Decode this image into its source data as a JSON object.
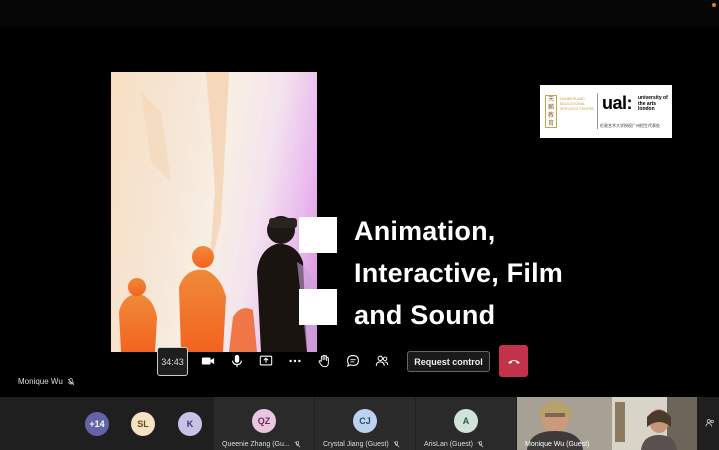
{
  "slide": {
    "title_lines": [
      "Animation,",
      "Interactive, Film",
      "and Sound"
    ],
    "logo": {
      "cn_vertical": "天麟教育",
      "en_text": "DUNBERLAND EDUCATIONAL SERVICES CENTRE",
      "ual_mark": "ual:",
      "ual_sub": "university of the arts london",
      "cn_sub": "伦敦艺术大学授权广州招生代表处"
    }
  },
  "toolbar": {
    "timer": "34:43",
    "request_control_label": "Request control"
  },
  "presenter": {
    "name": "Monique Wu"
  },
  "participants": {
    "overflow_count": "+14",
    "avatars": [
      {
        "initials": "SL",
        "bg": "#f3e3c3",
        "fg": "#6b4b1b"
      },
      {
        "initials": "K",
        "bg": "#c8c3e6",
        "fg": "#3d3570"
      }
    ],
    "tiles": [
      {
        "initials": "QZ",
        "name": "Queenie Zhang (Gu...",
        "bg": "#e9c8df",
        "fg": "#6a2f5b"
      },
      {
        "initials": "CJ",
        "name": "Crystal Jiang (Guest)",
        "bg": "#bcd2ee",
        "fg": "#2d4a70"
      },
      {
        "initials": "A",
        "name": "ArisLan (Guest)",
        "bg": "#cfe3d9",
        "fg": "#2d5a45"
      }
    ],
    "video_tile_name": "Monique Wu (Guest)"
  },
  "colors": {
    "accent_hangup": "#c4314b",
    "overflow_avatar": "#6264a7"
  }
}
